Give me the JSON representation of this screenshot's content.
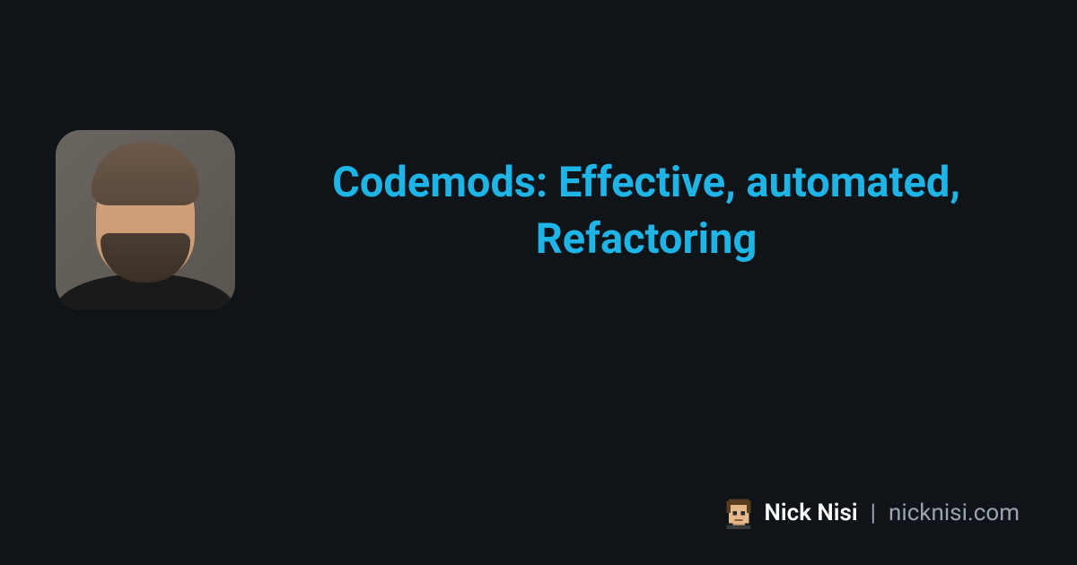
{
  "title": "Codemods: Effective, automated, Refactoring",
  "footer": {
    "author_name": "Nick Nisi",
    "separator": "|",
    "domain": "nicknisi.com"
  },
  "colors": {
    "background": "#0f1419",
    "accent": "#1fb4e6",
    "text_primary": "#ffffff",
    "text_secondary": "#9ca3af"
  }
}
